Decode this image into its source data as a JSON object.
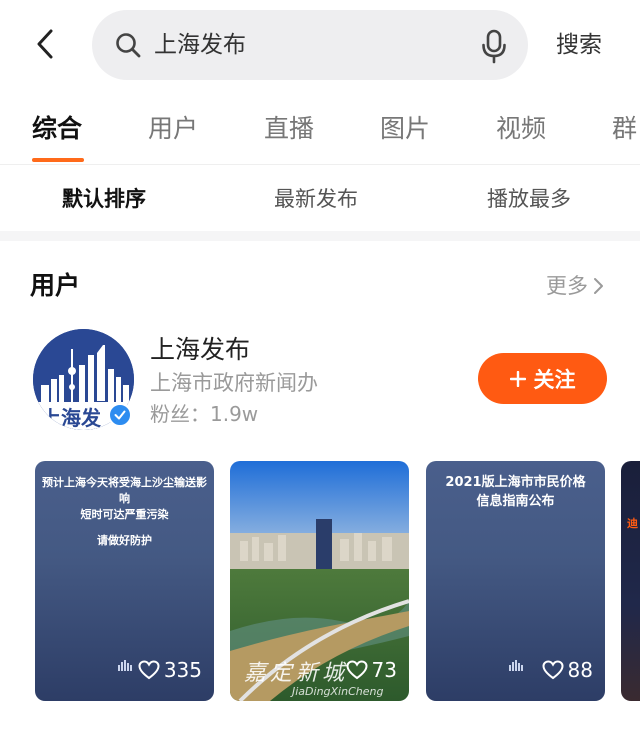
{
  "search": {
    "query": "上海发布",
    "button_label": "搜索"
  },
  "tabs": [
    {
      "label": "综合",
      "active": true
    },
    {
      "label": "用户",
      "active": false
    },
    {
      "label": "直播",
      "active": false
    },
    {
      "label": "图片",
      "active": false
    },
    {
      "label": "视频",
      "active": false
    },
    {
      "label": "群",
      "active": false
    }
  ],
  "sort": [
    {
      "label": "默认排序",
      "active": true
    },
    {
      "label": "最新发布",
      "active": false
    },
    {
      "label": "播放最多",
      "active": false
    }
  ],
  "users_section": {
    "title": "用户",
    "more_label": "更多",
    "user": {
      "name": "上海发布",
      "description": "上海市政府新闻办",
      "fans": "粉丝：1.9w",
      "avatar_text": "上海发",
      "follow_label": "关注"
    }
  },
  "videos": [
    {
      "caption_lines": [
        "预计上海今天将受海上沙尘输送影响",
        "短时可达严重污染"
      ],
      "caption_sub": "请做好防护",
      "likes": "335"
    },
    {
      "watermark": "嘉定新城",
      "watermark_sub": "JiaDingXinCheng",
      "likes": "73"
    },
    {
      "caption_lines": [
        "2021版上海市市民价格",
        "信息指南公布"
      ],
      "likes": "88"
    },
    {
      "caption_lines": [
        "迪"
      ]
    }
  ],
  "colors": {
    "accent": "#ff5a12",
    "tab_underline": "#ff6a1a",
    "avatar_bg": "#2a4894",
    "verified": "#2d8cf0",
    "card_bg": "#445983"
  }
}
